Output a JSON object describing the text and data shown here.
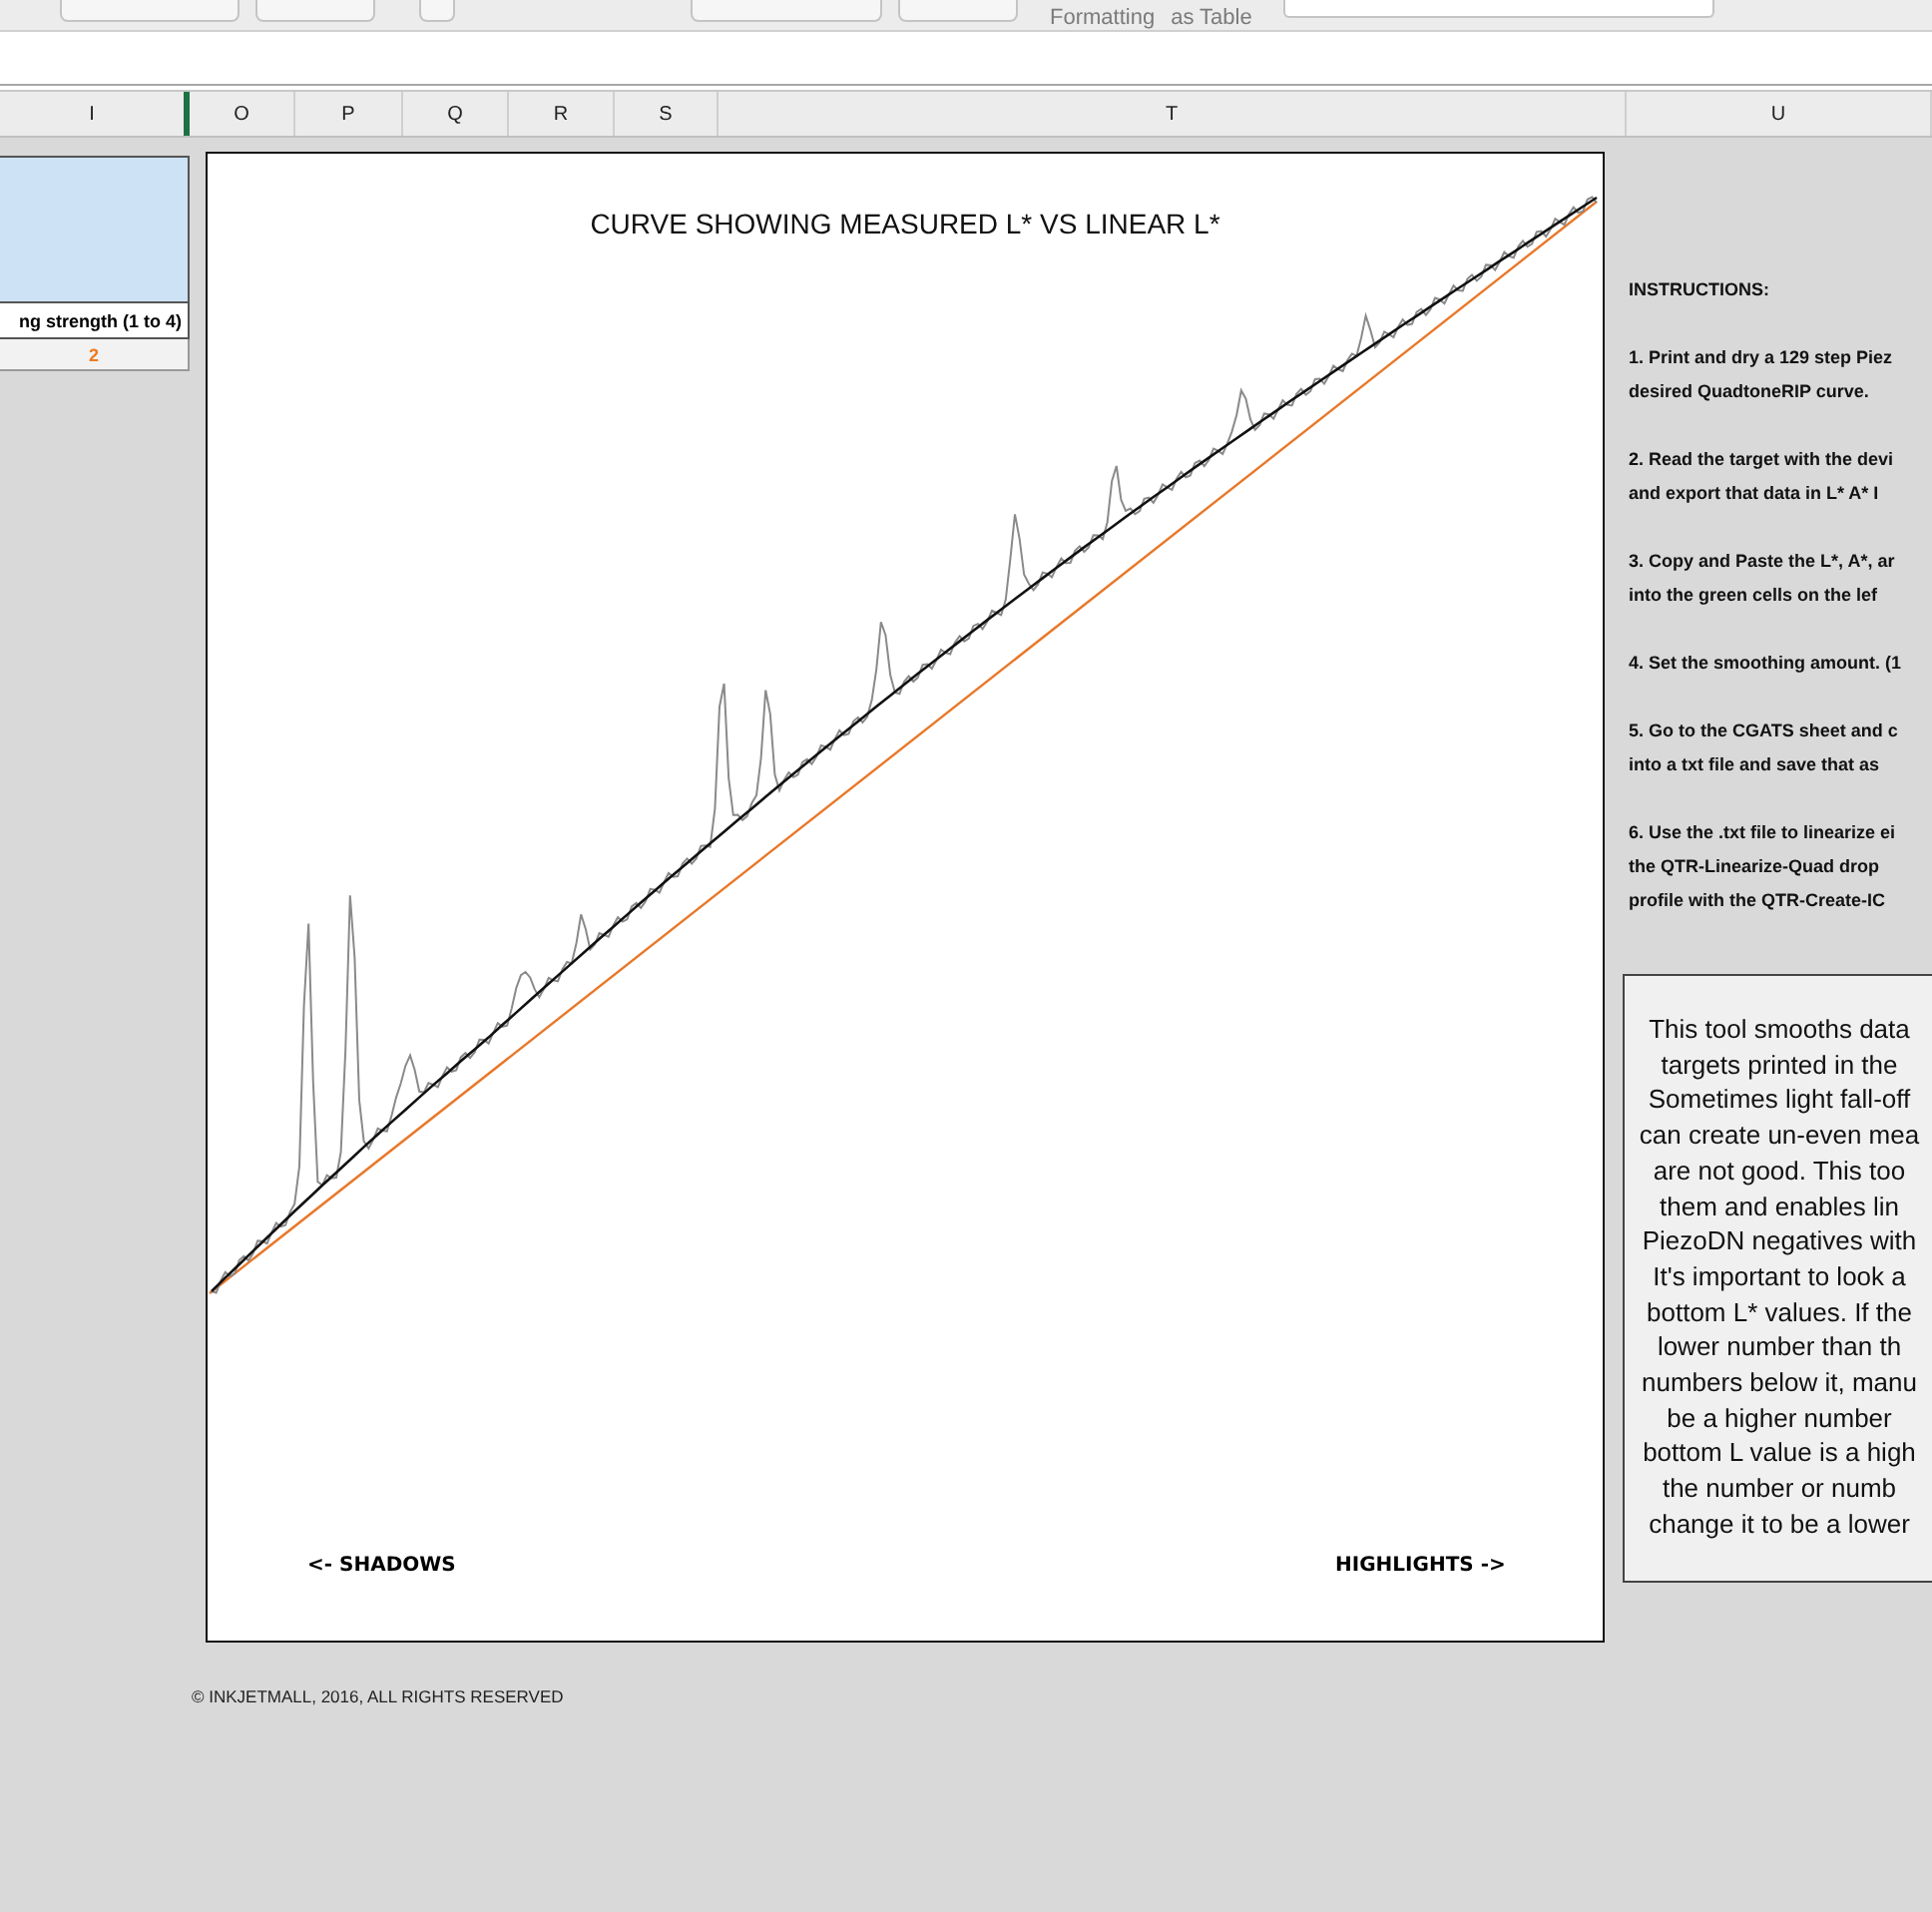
{
  "ribbon": {
    "labels": [
      "Formatting",
      "as Table"
    ]
  },
  "column_headers": [
    {
      "label": "I",
      "selected": false
    },
    {
      "label": "O",
      "selected": false
    },
    {
      "label": "P",
      "selected": false
    },
    {
      "label": "Q",
      "selected": false
    },
    {
      "label": "R",
      "selected": false
    },
    {
      "label": "S",
      "selected": false
    },
    {
      "label": "T",
      "selected": false
    },
    {
      "label": "U",
      "selected": false
    }
  ],
  "smoothing": {
    "label": "ng strength (1 to 4)",
    "value": "2"
  },
  "chart": {
    "title": "CURVE SHOWING MEASURED L* VS LINEAR L*",
    "left_label": "<- SHADOWS",
    "right_label": "HIGHLIGHTS ->"
  },
  "instructions": {
    "title": "INSTRUCTIONS:",
    "steps": [
      [
        "1. Print and dry a 129 step Piez",
        "desired QuadtoneRIP curve."
      ],
      [
        "2. Read the target with the devi",
        "and export that data in L* A* I"
      ],
      [
        "3. Copy and Paste the L*, A*, ar",
        "into the green cells on the lef"
      ],
      [
        "4. Set the smoothing amount. (1"
      ],
      [
        "5. Go to the CGATS sheet and c",
        "into a txt file and save that as"
      ],
      [
        "6. Use the .txt file to linearize ei",
        "the QTR-Linearize-Quad drop",
        "profile with the QTR-Create-IC"
      ]
    ]
  },
  "note": {
    "lines": [
      "This tool smooths data",
      "targets printed in the",
      "Sometimes light fall-off",
      "can create un-even mea",
      "are not good. This too",
      "them and enables lin",
      "PiezoDN negatives with",
      "It's important to look a",
      "bottom L* values. If the",
      "lower number than th",
      "numbers below it, manu",
      "be a higher number",
      "bottom L value is a high",
      "the number or numb",
      "change it to be a lower"
    ]
  },
  "copyright": "© INKJETMALL, 2016, ALL RIGHTS RESERVED"
}
